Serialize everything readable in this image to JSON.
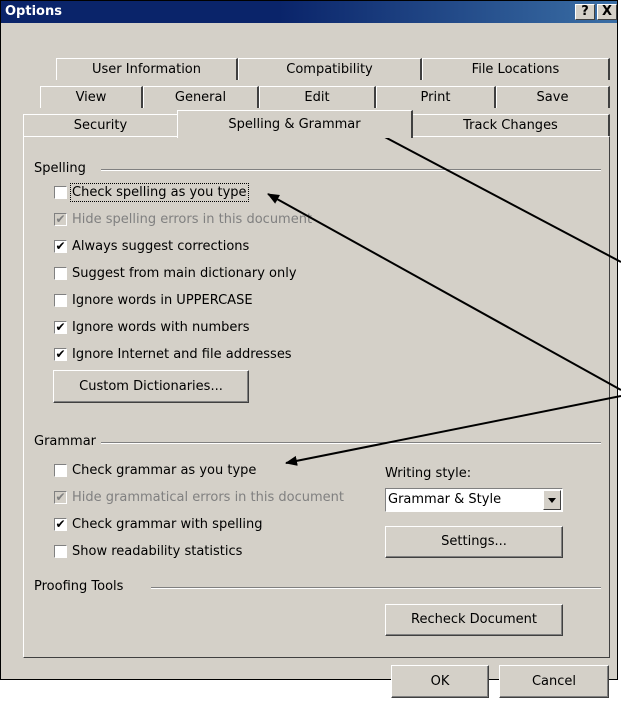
{
  "window": {
    "title": "Options",
    "help_label": "?",
    "close_label": "X"
  },
  "tabs": {
    "row1": [
      "User Information",
      "Compatibility",
      "File Locations"
    ],
    "row2": [
      "View",
      "General",
      "Edit",
      "Print",
      "Save"
    ],
    "row3": [
      "Security",
      "Spelling & Grammar",
      "Track Changes"
    ],
    "active": "Spelling & Grammar"
  },
  "spelling": {
    "label": "Spelling",
    "items": [
      {
        "label": "Check spelling as you type",
        "checked": false,
        "disabled": false
      },
      {
        "label": "Hide spelling errors in this document",
        "checked": true,
        "disabled": true
      },
      {
        "label": "Always suggest corrections",
        "checked": true,
        "disabled": false
      },
      {
        "label": "Suggest from main dictionary only",
        "checked": false,
        "disabled": false
      },
      {
        "label": "Ignore words in UPPERCASE",
        "checked": false,
        "disabled": false
      },
      {
        "label": "Ignore words with numbers",
        "checked": true,
        "disabled": false
      },
      {
        "label": "Ignore Internet and file addresses",
        "checked": true,
        "disabled": false
      }
    ],
    "custom_dict_button": "Custom Dictionaries..."
  },
  "grammar": {
    "label": "Grammar",
    "items": [
      {
        "label": "Check grammar as you type",
        "checked": false,
        "disabled": false
      },
      {
        "label": "Hide grammatical errors in this document",
        "checked": true,
        "disabled": true
      },
      {
        "label": "Check grammar with spelling",
        "checked": true,
        "disabled": false
      },
      {
        "label": "Show readability statistics",
        "checked": false,
        "disabled": false
      }
    ],
    "writing_style_label": "Writing style:",
    "writing_style_value": "Grammar & Style",
    "settings_button": "Settings..."
  },
  "proofing": {
    "label": "Proofing Tools",
    "recheck_button": "Recheck Document"
  },
  "footer": {
    "ok_label": "OK",
    "cancel_label": "Cancel"
  },
  "colors": {
    "dialog_bg": "#d4d0c8",
    "titlebar": "#0a246a",
    "annotation": "#000000"
  }
}
